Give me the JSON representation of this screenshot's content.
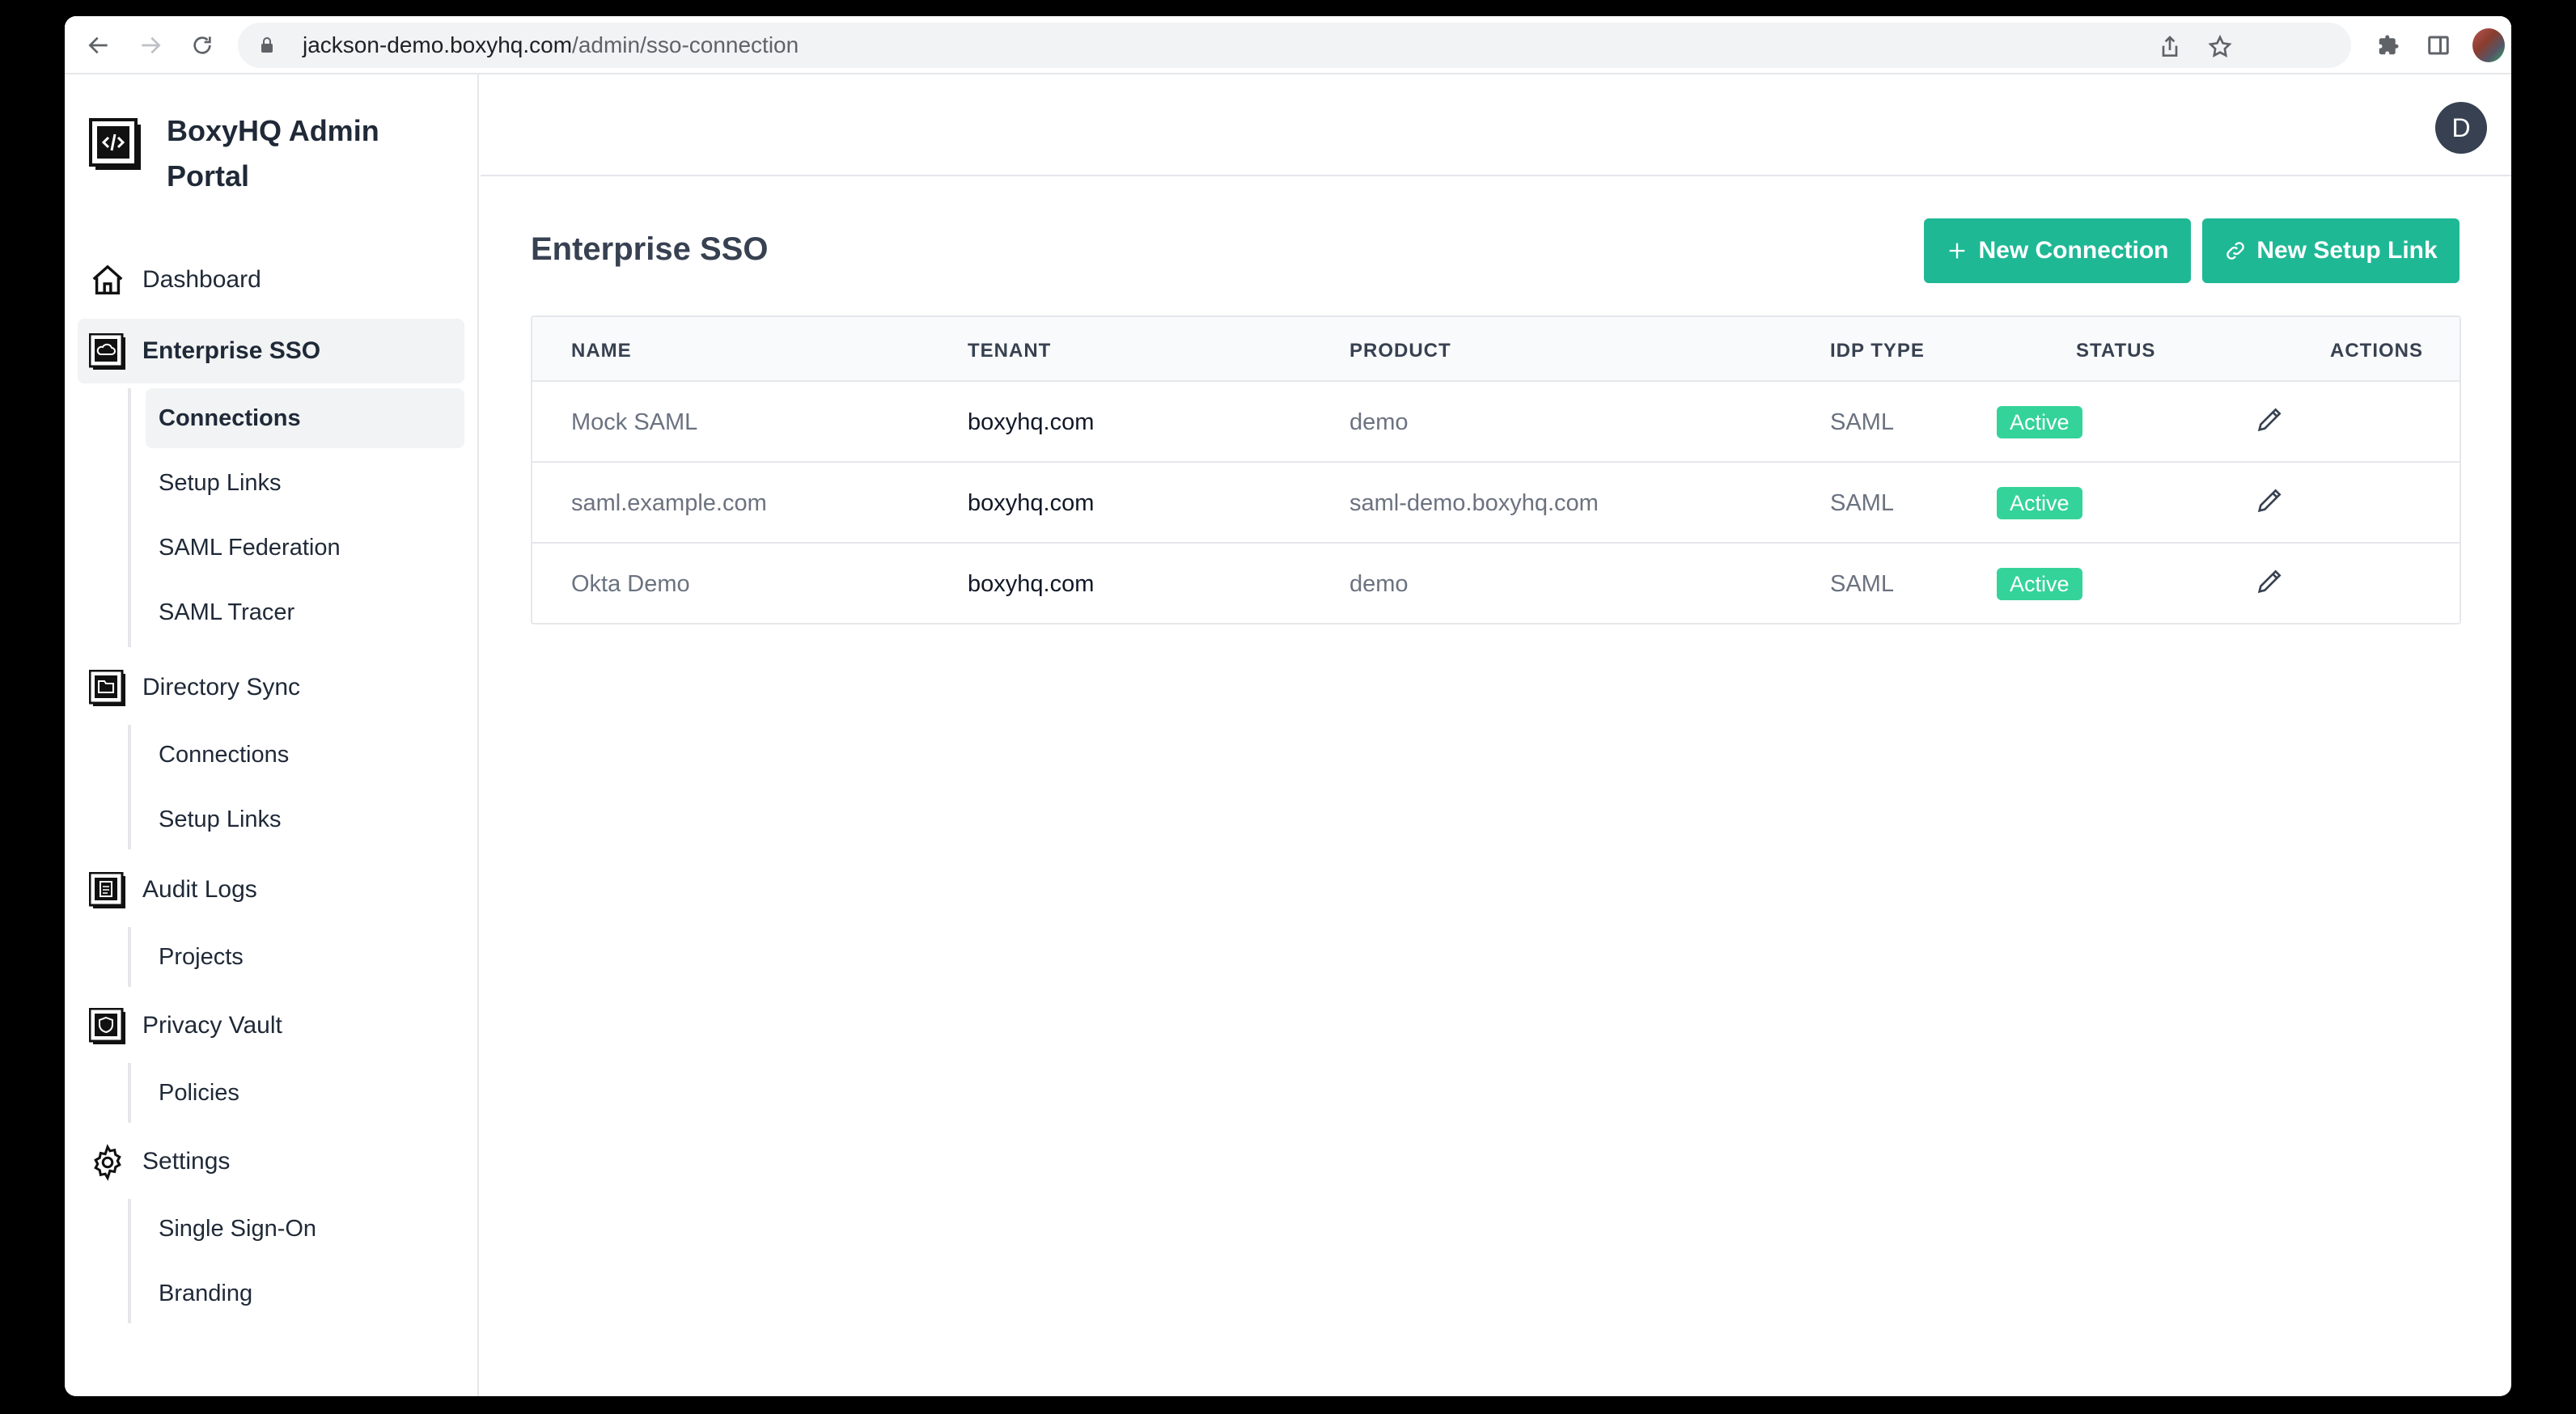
{
  "browser": {
    "url_host": "jackson-demo.boxyhq.com",
    "url_path": "/admin/sso-connection",
    "icons": [
      "back-icon",
      "forward-icon",
      "reload-icon",
      "lock-icon",
      "share-icon",
      "star-icon",
      "extensions-icon",
      "sidepanel-icon",
      "profile-avatar",
      "menu-icon"
    ]
  },
  "brand": {
    "name": "BoxyHQ Admin Portal"
  },
  "sidebar": {
    "dashboard": "Dashboard",
    "enterprise_sso": "Enterprise SSO",
    "sso_connections": "Connections",
    "sso_setup_links": "Setup Links",
    "saml_federation": "SAML Federation",
    "saml_tracer": "SAML Tracer",
    "directory_sync": "Directory Sync",
    "dsync_connections": "Connections",
    "dsync_setup_links": "Setup Links",
    "audit_logs": "Audit Logs",
    "projects": "Projects",
    "privacy_vault": "Privacy Vault",
    "policies": "Policies",
    "settings": "Settings",
    "single_sign_on": "Single Sign-On",
    "branding": "Branding"
  },
  "user": {
    "initial": "D"
  },
  "main": {
    "title": "Enterprise SSO",
    "new_connection": "New Connection",
    "new_setup_link": "New Setup Link",
    "columns": [
      "NAME",
      "TENANT",
      "PRODUCT",
      "IDP TYPE",
      "STATUS",
      "ACTIONS"
    ],
    "rows": [
      {
        "name": "Mock SAML",
        "tenant": "boxyhq.com",
        "product": "demo",
        "idp": "SAML",
        "status": "Active"
      },
      {
        "name": "saml.example.com",
        "tenant": "boxyhq.com",
        "product": "saml-demo.boxyhq.com",
        "idp": "SAML",
        "status": "Active"
      },
      {
        "name": "Okta Demo",
        "tenant": "boxyhq.com",
        "product": "demo",
        "idp": "SAML",
        "status": "Active"
      }
    ]
  },
  "colors": {
    "accent": "#1fb895",
    "badge": "#34d399",
    "active_bg": "#f1f3f4"
  }
}
